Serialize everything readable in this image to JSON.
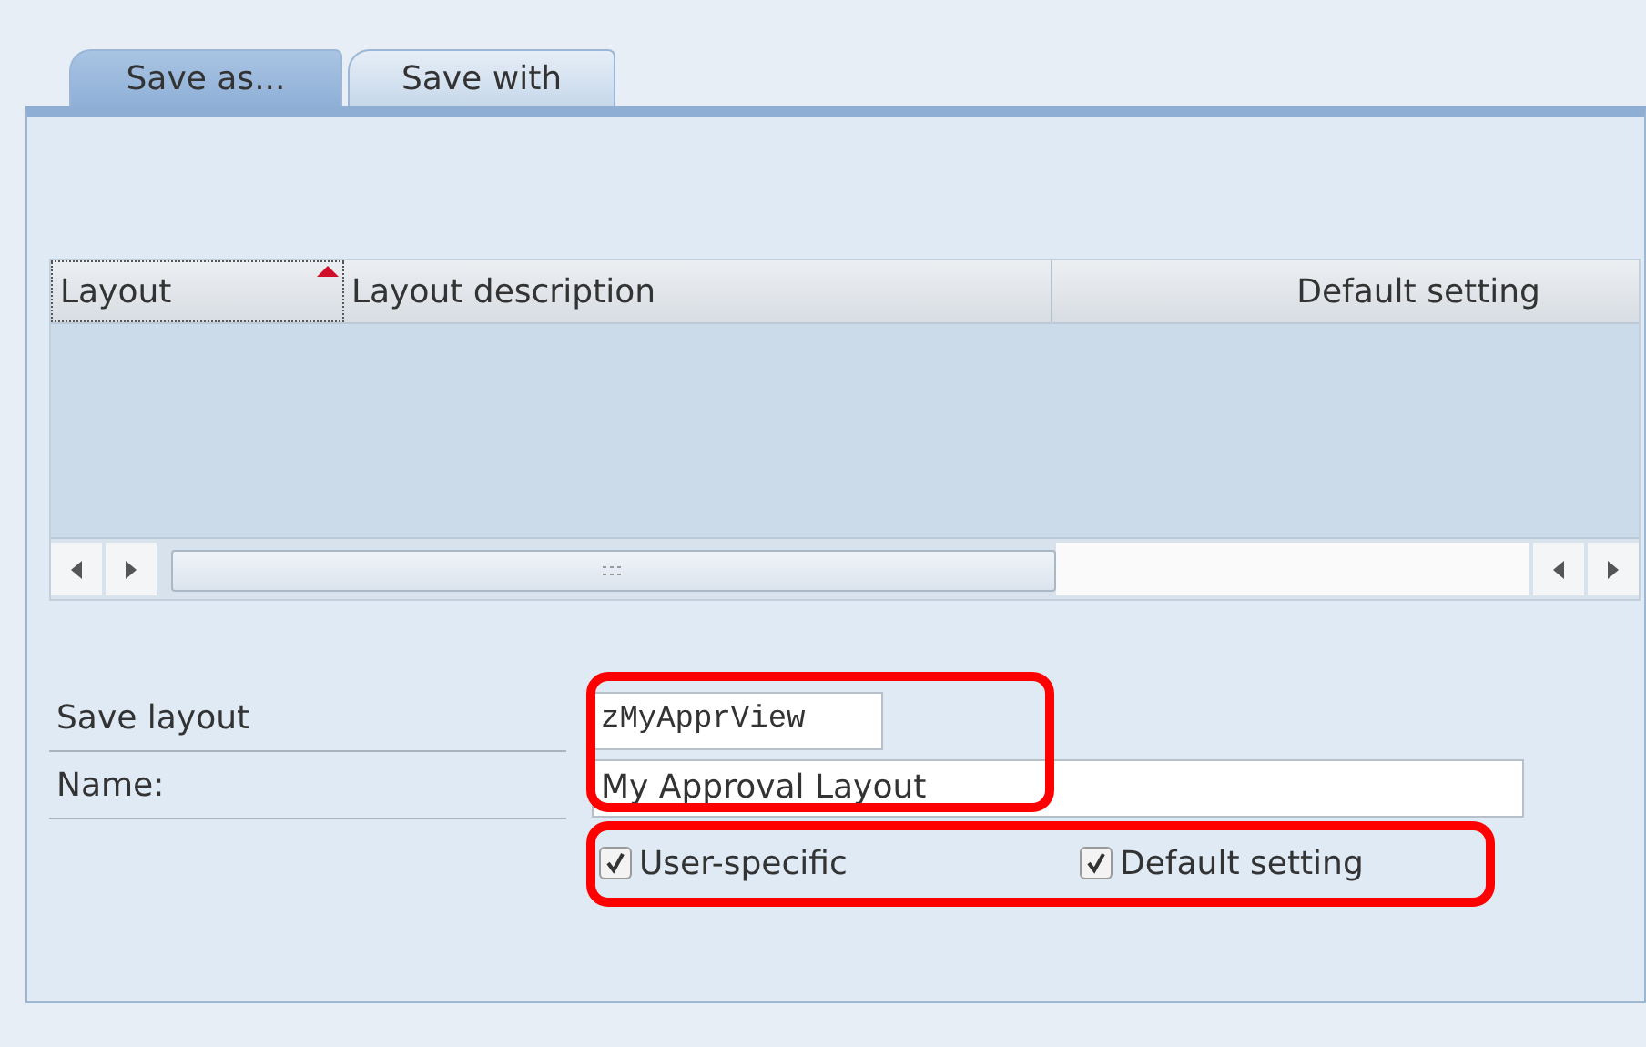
{
  "tabs": [
    {
      "label": "Save as...",
      "selected": true
    },
    {
      "label": "Save with",
      "selected": false
    }
  ],
  "table": {
    "columns": [
      {
        "label": "Layout",
        "sorted": true
      },
      {
        "label": "Layout description",
        "sorted": false
      },
      {
        "label": "Default setting",
        "sorted": false
      }
    ]
  },
  "form": {
    "fields": [
      {
        "label": "Save layout",
        "value": "zMyApprView",
        "kind": "short"
      },
      {
        "label": "Name:",
        "value": "My Approval Layout",
        "kind": "long"
      }
    ],
    "checkboxes": [
      {
        "label": "User-specific",
        "checked": true
      },
      {
        "label": "Default setting",
        "checked": true
      }
    ]
  }
}
